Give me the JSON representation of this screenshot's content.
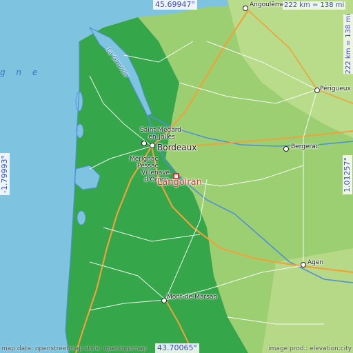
{
  "map": {
    "focus_place": "Langoiran",
    "colors": {
      "sea": "#7ec3df",
      "lowland": "#36a64a",
      "hill": "#9ccf72",
      "motorway": "#f0a23a",
      "road": "#ffffff",
      "river": "#4f8fd6",
      "marker": "#e03030",
      "coord_text": "#3b48c8"
    }
  },
  "coords": {
    "top": "45.69947°",
    "bottom": "43.70065°",
    "left": "-1.79993°",
    "right": "1.01257°"
  },
  "scale": {
    "horizontal": "222 km = 138 mi",
    "vertical": "222 km = 138 mi"
  },
  "places": [
    {
      "id": "angouleme",
      "label": "Angoulême"
    },
    {
      "id": "perigueux",
      "label": "Périgueux"
    },
    {
      "id": "saint-medard",
      "label": "Saint-Médard-\nen-Jalles"
    },
    {
      "id": "bordeaux",
      "label": "Bordeaux"
    },
    {
      "id": "merignac",
      "label": "Mérignac"
    },
    {
      "id": "pessac",
      "label": "Pessac"
    },
    {
      "id": "villenave",
      "label": "Villenave-\nd'Ornon"
    },
    {
      "id": "bergerac",
      "label": "Bergerac"
    },
    {
      "id": "agen",
      "label": "Agen"
    },
    {
      "id": "mont-de-marsan",
      "label": "Mont-de-Marsan"
    },
    {
      "id": "la-gironde",
      "label": "La Gironde"
    },
    {
      "id": "ocean",
      "label": "g n e"
    }
  ],
  "credits": {
    "left": "map data: openstreetmap  style: opentopomap",
    "right": "image prod.: elevation.city"
  }
}
